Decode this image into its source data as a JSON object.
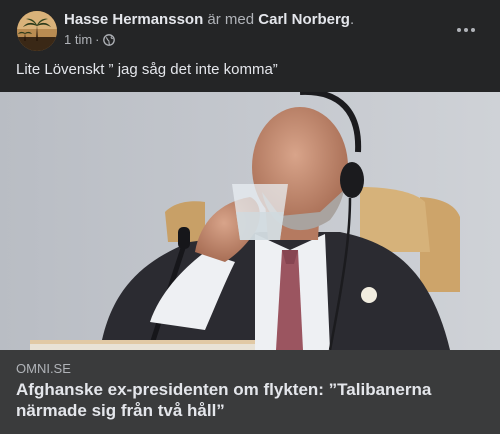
{
  "post": {
    "author": "Hasse Hermansson",
    "with_text": "är med",
    "tagged": "Carl Norberg",
    "tagged_suffix": ".",
    "time": "1 tim",
    "separator": "·",
    "privacy_icon": "globe-icon",
    "menu_icon": "more-options-icon",
    "text": "Lite Lövenskt ” jag såg det inte komma”"
  },
  "link": {
    "source": "OMNI.SE",
    "headline": "Afghanske ex-presidenten om flykten: ”Talibanerna närmade sig från två håll”"
  },
  "colors": {
    "card_background": "#242526",
    "caption_background": "#3a3b3c",
    "primary_text": "#e4e6eb",
    "secondary_text": "#b0b3b8"
  }
}
